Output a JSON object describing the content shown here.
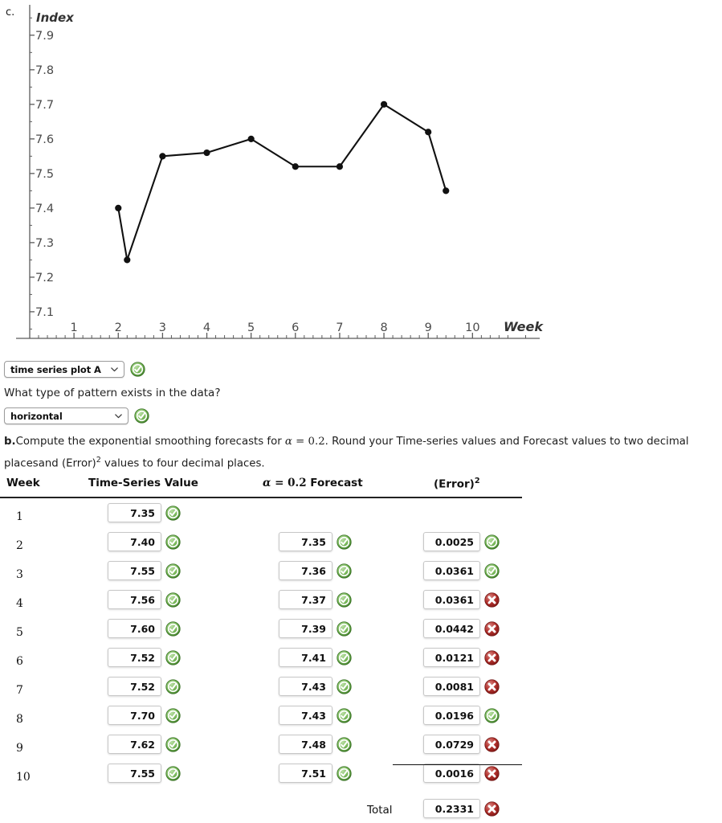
{
  "part_label": "c.",
  "chart_data": {
    "type": "line",
    "title": "",
    "ylabel": "Index",
    "xlabel": "Week",
    "xlim": [
      0,
      11.3
    ],
    "ylim": [
      7.03,
      7.96
    ],
    "yticks": [
      "7.1",
      "7.2",
      "7.3",
      "7.4",
      "7.5",
      "7.6",
      "7.7",
      "7.8",
      "7.9"
    ],
    "ytick_values": [
      7.1,
      7.2,
      7.3,
      7.4,
      7.5,
      7.6,
      7.7,
      7.8,
      7.9
    ],
    "xticks": [
      "1",
      "2",
      "3",
      "4",
      "5",
      "6",
      "7",
      "8",
      "9",
      "10"
    ],
    "xtick_values": [
      1,
      2,
      3,
      4,
      5,
      6,
      7,
      8,
      9,
      10
    ],
    "grid": false,
    "legend": "none",
    "series": [
      {
        "name": "Index",
        "x": [
          2,
          2.2,
          3,
          4,
          5,
          6,
          7,
          8,
          9,
          9.4
        ],
        "values": [
          7.4,
          7.25,
          7.55,
          7.56,
          7.6,
          7.52,
          7.52,
          7.7,
          7.62,
          7.45
        ]
      }
    ]
  },
  "plot_select": {
    "value": "time series plot A",
    "status": "correct",
    "chevron": "chevron-down-icon"
  },
  "pattern_question": "What type of pattern exists in the data?",
  "pattern_select": {
    "value": "horizontal",
    "status": "correct",
    "chevron": "chevron-down-icon"
  },
  "prompt": {
    "letter": "b.",
    "line1_a": "Compute the exponential smoothing forecasts for ",
    "alpha": "α",
    "equals": " = ",
    "alpha_value": "0.2",
    "line1_b": ". Round your Time-series values and Forecast values to two decimal places",
    "line2_a": "and (Error)",
    "line2_sup": "2",
    "line2_b": " values to four decimal places."
  },
  "table": {
    "headers": {
      "week": "Week",
      "value": "Time-Series Value",
      "forecast_alpha": "α",
      "forecast_equals": " = ",
      "forecast_alpha_value": "0.2",
      "forecast": " Forecast",
      "error": "(Error)",
      "error_sup": "2"
    },
    "rows": [
      {
        "week": "1",
        "value": "7.35",
        "value_status": "correct",
        "forecast": "",
        "forecast_status": "none",
        "error": "",
        "error_status": "none"
      },
      {
        "week": "2",
        "value": "7.40",
        "value_status": "correct",
        "forecast": "7.35",
        "forecast_status": "correct",
        "error": "0.0025",
        "error_status": "correct"
      },
      {
        "week": "3",
        "value": "7.55",
        "value_status": "correct",
        "forecast": "7.36",
        "forecast_status": "correct",
        "error": "0.0361",
        "error_status": "correct"
      },
      {
        "week": "4",
        "value": "7.56",
        "value_status": "correct",
        "forecast": "7.37",
        "forecast_status": "correct",
        "error": "0.0361",
        "error_status": "incorrect"
      },
      {
        "week": "5",
        "value": "7.60",
        "value_status": "correct",
        "forecast": "7.39",
        "forecast_status": "correct",
        "error": "0.0442",
        "error_status": "incorrect"
      },
      {
        "week": "6",
        "value": "7.52",
        "value_status": "correct",
        "forecast": "7.41",
        "forecast_status": "correct",
        "error": "0.0121",
        "error_status": "incorrect"
      },
      {
        "week": "7",
        "value": "7.52",
        "value_status": "correct",
        "forecast": "7.43",
        "forecast_status": "correct",
        "error": "0.0081",
        "error_status": "incorrect"
      },
      {
        "week": "8",
        "value": "7.70",
        "value_status": "correct",
        "forecast": "7.43",
        "forecast_status": "correct",
        "error": "0.0196",
        "error_status": "correct"
      },
      {
        "week": "9",
        "value": "7.62",
        "value_status": "correct",
        "forecast": "7.48",
        "forecast_status": "correct",
        "error": "0.0729",
        "error_status": "incorrect"
      },
      {
        "week": "10",
        "value": "7.55",
        "value_status": "correct",
        "forecast": "7.51",
        "forecast_status": "correct",
        "error": "0.0016",
        "error_status": "incorrect"
      }
    ],
    "total_label": "Total",
    "total_value": "0.2331",
    "total_status": "incorrect"
  },
  "colors": {
    "correct_green": "#3f8a2e",
    "incorrect_red": "#a5221f",
    "line_black": "#111111",
    "axis_gray": "#555555"
  }
}
